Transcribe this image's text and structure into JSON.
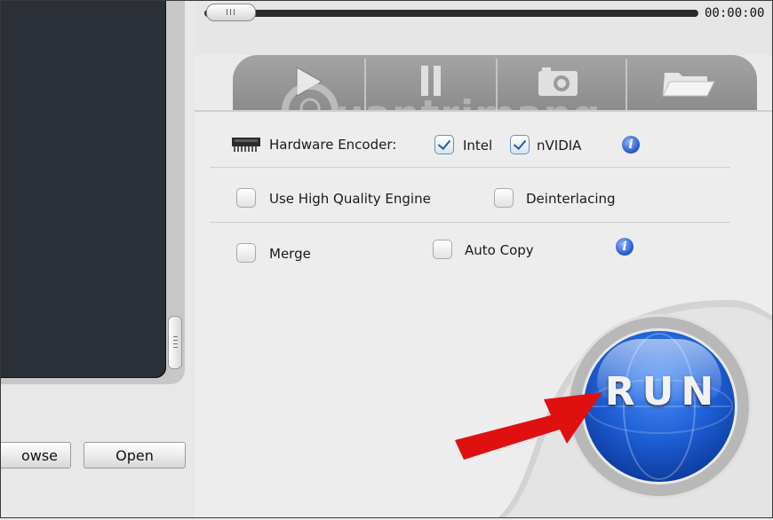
{
  "player": {
    "time": "00:00:00"
  },
  "buttons": {
    "browse_label": "owse",
    "open_label": "Open"
  },
  "tabs": [
    {
      "name": "play"
    },
    {
      "name": "pause"
    },
    {
      "name": "snapshot"
    },
    {
      "name": "open-folder"
    }
  ],
  "hardware_encoder": {
    "label": "Hardware Encoder:",
    "intel": {
      "label": "Intel",
      "checked": true
    },
    "nvidia": {
      "label": "nVIDIA",
      "checked": true
    }
  },
  "options": {
    "high_quality": {
      "label": "Use High Quality Engine",
      "checked": false
    },
    "deinterlacing": {
      "label": "Deinterlacing",
      "checked": false
    },
    "merge": {
      "label": "Merge",
      "checked": false
    },
    "auto_copy": {
      "label": "Auto Copy",
      "checked": false
    }
  },
  "run": {
    "label": "RUN"
  },
  "watermark": {
    "text": "uantrimang"
  },
  "colors": {
    "run_blue": "#1e5fd6",
    "checkbox_check": "#1f5fa8",
    "arrow_red": "#e01010",
    "tab_gray": "#9a9a9a"
  }
}
